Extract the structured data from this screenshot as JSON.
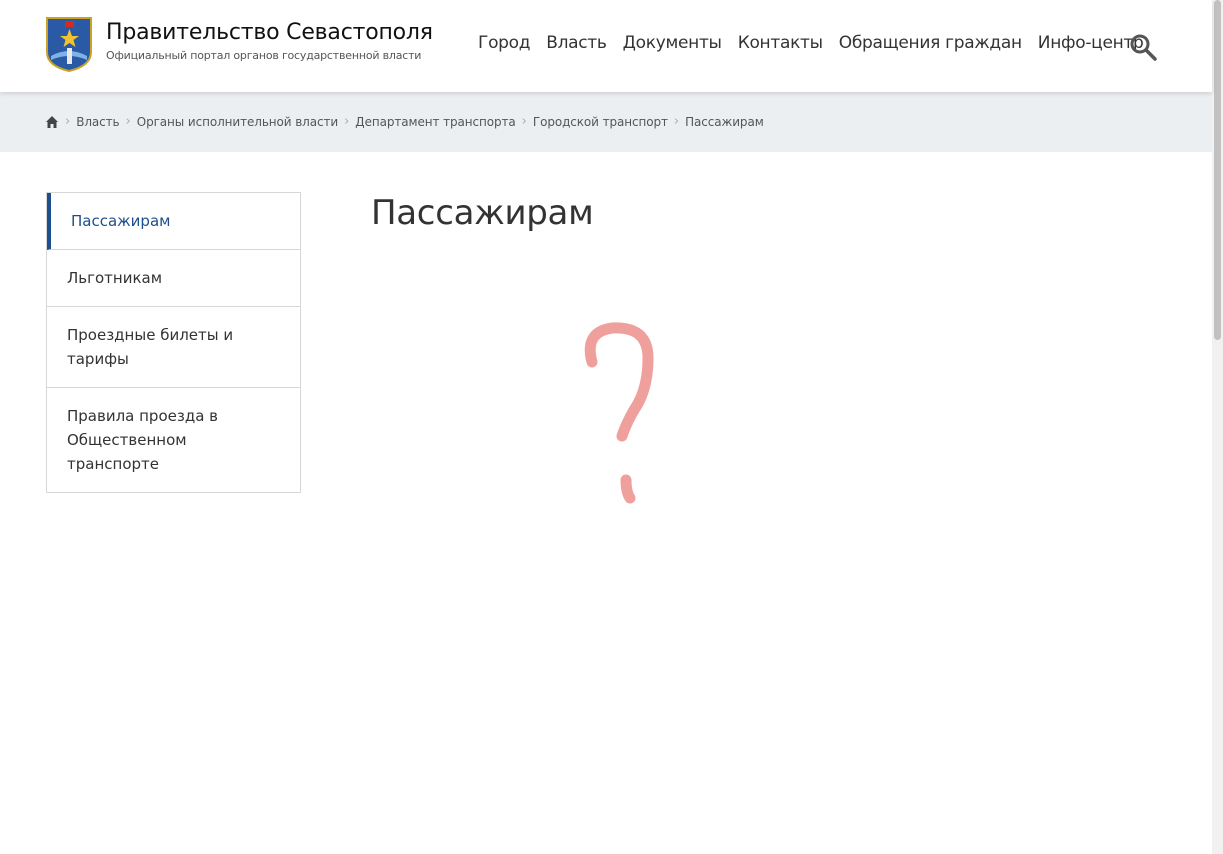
{
  "header": {
    "title": "Правительство Севастополя",
    "subtitle": "Официальный портал органов государственной власти",
    "nav": [
      "Город",
      "Власть",
      "Документы",
      "Контакты",
      "Обращения граждан",
      "Инфо-центр"
    ]
  },
  "breadcrumbs": [
    "Власть",
    "Органы исполнительной власти",
    "Департамент транспорта",
    "Городской транспорт",
    "Пассажирам"
  ],
  "sidebar": {
    "items": [
      {
        "label": "Пассажирам",
        "active": true
      },
      {
        "label": "Льготникам",
        "active": false
      },
      {
        "label": "Проездные билеты и тарифы",
        "active": false
      },
      {
        "label": "Правила проезда в Общественном транспорте",
        "active": false
      }
    ]
  },
  "main": {
    "title": "Пассажирам"
  },
  "colors": {
    "accent": "#1c4f8c",
    "breadcrumb_bg": "#eceff2",
    "question_mark": "#f0a09c"
  }
}
